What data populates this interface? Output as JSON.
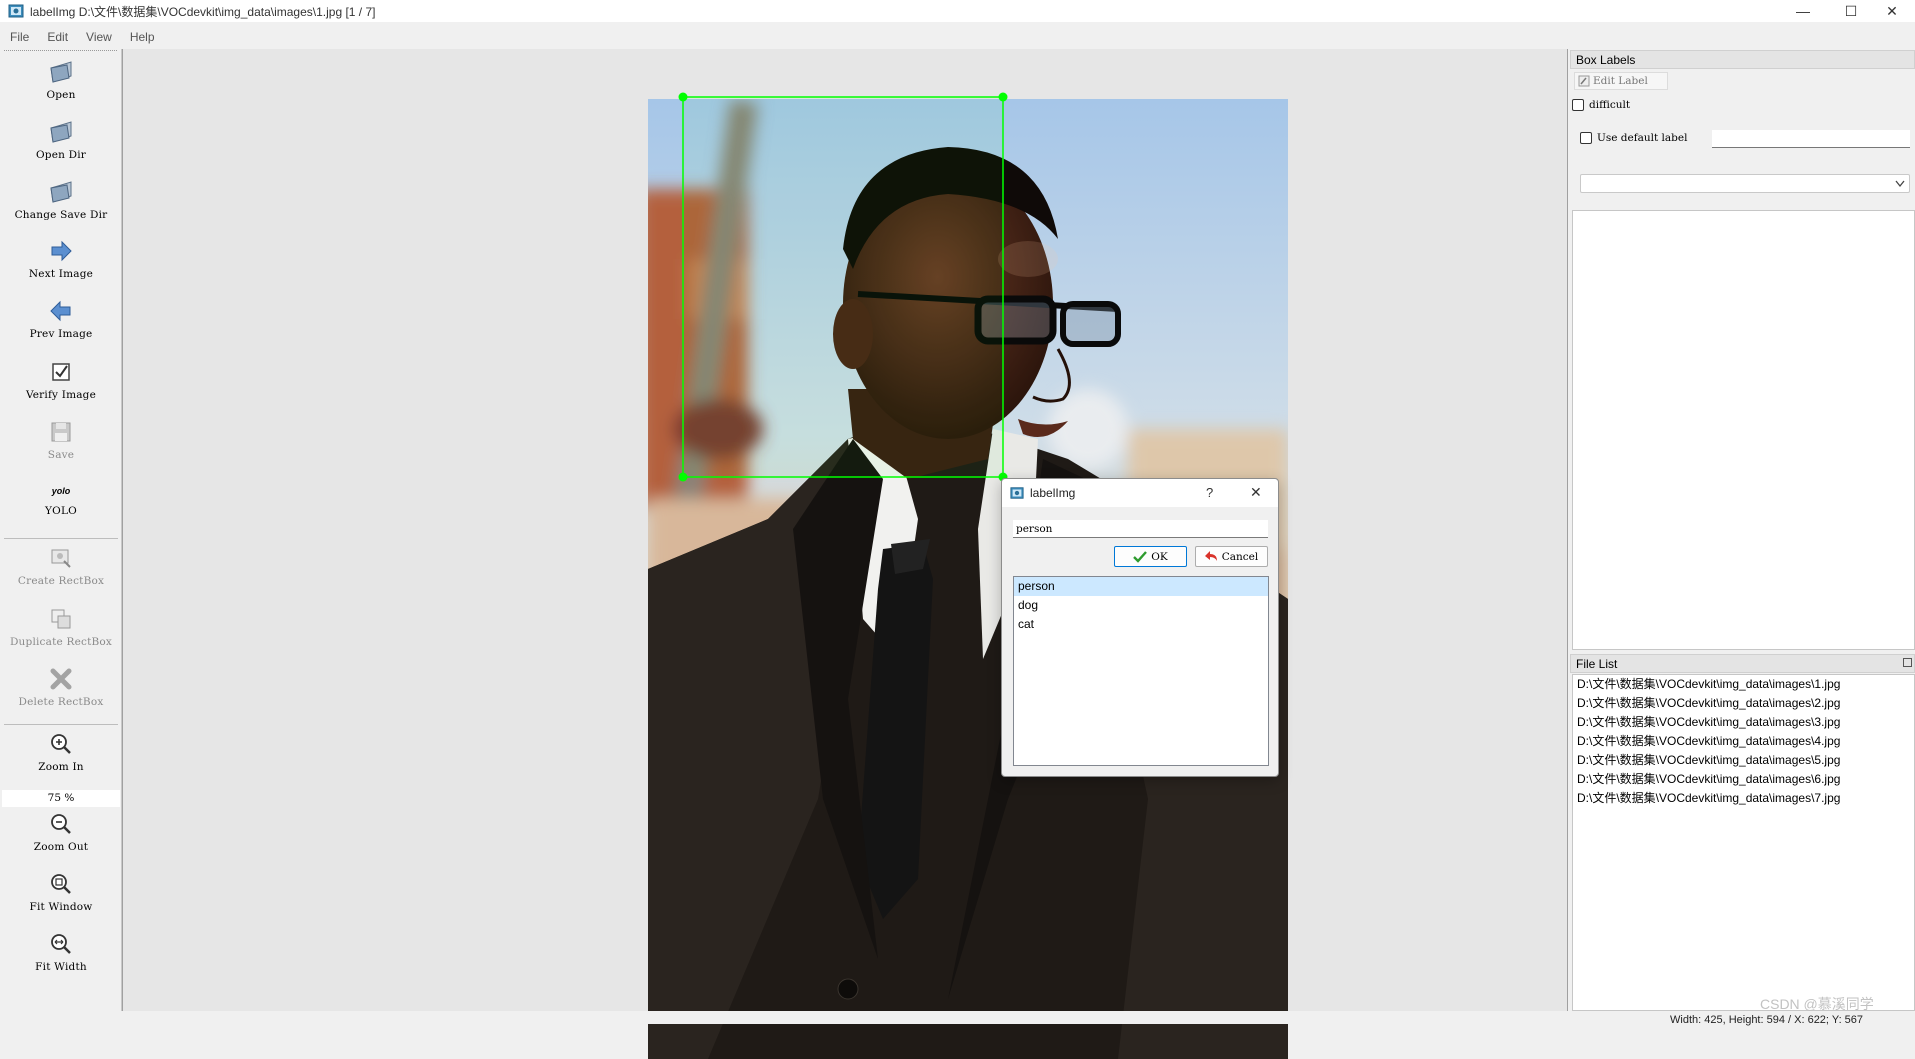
{
  "window": {
    "title": "labelImg D:\\文件\\数据集\\VOCdevkit\\img_data\\images\\1.jpg [1 / 7]",
    "minimize_glyph": "—",
    "maximize_glyph": "☐",
    "close_glyph": "✕"
  },
  "menu": [
    "File",
    "Edit",
    "View",
    "Help"
  ],
  "toolbar": {
    "open": "Open",
    "open_dir": "Open Dir",
    "change_save_dir": "Change Save Dir",
    "next_image": "Next Image",
    "prev_image": "Prev Image",
    "verify_image": "Verify Image",
    "save": "Save",
    "format_icon_text": "yolo",
    "format": "YOLO",
    "create_rectbox": "Create RectBox",
    "duplicate_rectbox": "Duplicate RectBox",
    "delete_rectbox": "Delete RectBox",
    "zoom_in": "Zoom In",
    "zoom_value": "75 %",
    "zoom_out": "Zoom Out",
    "fit_window": "Fit Window",
    "fit_width": "Fit Width"
  },
  "dialog": {
    "title": "labelImg",
    "help_glyph": "?",
    "close_glyph": "✕",
    "input_value": "person",
    "ok": "OK",
    "cancel": "Cancel",
    "labels": [
      "person",
      "dog",
      "cat"
    ],
    "selected_index": 0
  },
  "box_labels": {
    "title": "Box Labels",
    "edit_label": "Edit Label",
    "difficult": "difficult",
    "use_default_label": "Use default label",
    "default_label_value": ""
  },
  "file_list": {
    "title": "File List",
    "files": [
      "D:\\文件\\数据集\\VOCdevkit\\img_data\\images\\1.jpg",
      "D:\\文件\\数据集\\VOCdevkit\\img_data\\images\\2.jpg",
      "D:\\文件\\数据集\\VOCdevkit\\img_data\\images\\3.jpg",
      "D:\\文件\\数据集\\VOCdevkit\\img_data\\images\\4.jpg",
      "D:\\文件\\数据集\\VOCdevkit\\img_data\\images\\5.jpg",
      "D:\\文件\\数据集\\VOCdevkit\\img_data\\images\\6.jpg",
      "D:\\文件\\数据集\\VOCdevkit\\img_data\\images\\7.jpg"
    ]
  },
  "status": "Width: 425, Height: 594 / X: 622; Y: 567",
  "watermark": "CSDN @慕溪同学",
  "colors": {
    "bbox": "#00ff00",
    "selection": "#cce8ff",
    "ok_border": "#0078d7"
  },
  "icons": {
    "app": "labelimg-app-icon",
    "open": "folder-icon",
    "next": "arrow-right-icon",
    "prev": "arrow-left-icon",
    "verify": "checkbox-icon",
    "save": "floppy-disk-icon",
    "zoom_in": "zoom-in-icon",
    "zoom_out": "zoom-out-icon",
    "fit_window": "fit-window-icon",
    "fit_width": "fit-width-icon"
  }
}
